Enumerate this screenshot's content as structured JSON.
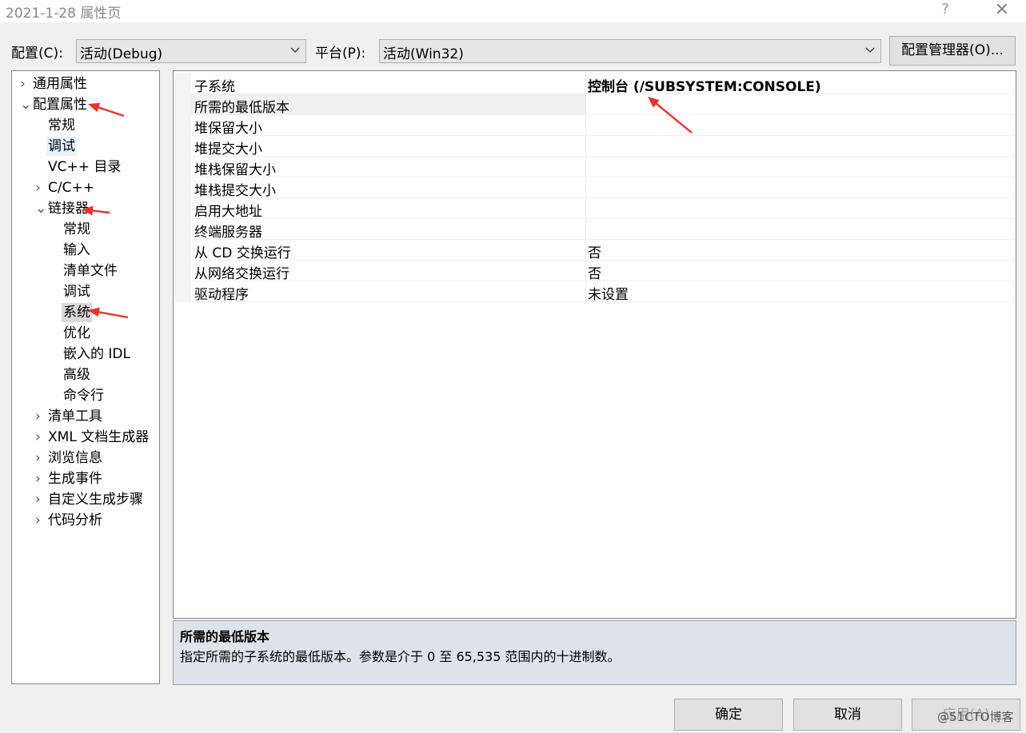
{
  "window": {
    "title": "2021-1-28 属性页",
    "help": "?",
    "close": "✕"
  },
  "config": {
    "label": "配置(C):",
    "value": "活动(Debug)"
  },
  "platform": {
    "label": "平台(P):",
    "value": "活动(Win32)"
  },
  "config_manager_label": "配置管理器(O)...",
  "tree": {
    "items": [
      {
        "label": "通用属性",
        "expander": "›"
      },
      {
        "label": "配置属性",
        "expander": "⌄"
      },
      {
        "label": "常规"
      },
      {
        "label": "调试"
      },
      {
        "label": "VC++ 目录"
      },
      {
        "label": "C/C++",
        "expander": "›"
      },
      {
        "label": "链接器",
        "expander": "⌄"
      },
      {
        "label": "常规"
      },
      {
        "label": "输入"
      },
      {
        "label": "清单文件"
      },
      {
        "label": "调试"
      },
      {
        "label": "系统"
      },
      {
        "label": "优化"
      },
      {
        "label": "嵌入的 IDL"
      },
      {
        "label": "高级"
      },
      {
        "label": "命令行"
      },
      {
        "label": "清单工具",
        "expander": "›"
      },
      {
        "label": "XML 文档生成器",
        "expander": "›"
      },
      {
        "label": "浏览信息",
        "expander": "›"
      },
      {
        "label": "生成事件",
        "expander": "›"
      },
      {
        "label": "自定义生成步骤",
        "expander": "›"
      },
      {
        "label": "代码分析",
        "expander": "›"
      }
    ]
  },
  "properties": [
    {
      "name": "子系统",
      "value": "控制台 (/SUBSYSTEM:CONSOLE)"
    },
    {
      "name": "所需的最低版本",
      "value": ""
    },
    {
      "name": "堆保留大小",
      "value": ""
    },
    {
      "name": "堆提交大小",
      "value": ""
    },
    {
      "name": "堆栈保留大小",
      "value": ""
    },
    {
      "name": "堆栈提交大小",
      "value": ""
    },
    {
      "name": "启用大地址",
      "value": ""
    },
    {
      "name": "终端服务器",
      "value": ""
    },
    {
      "name": "从 CD 交换运行",
      "value": "否"
    },
    {
      "name": "从网络交换运行",
      "value": "否"
    },
    {
      "name": "驱动程序",
      "value": "未设置"
    }
  ],
  "description": {
    "title": "所需的最低版本",
    "text": "指定所需的子系统的最低版本。参数是介于 0 至 65,535 范围内的十进制数。"
  },
  "buttons": {
    "ok": "确定",
    "cancel": "取消",
    "apply": "应用(A)"
  },
  "watermark": "@51CTO博客",
  "colors": {
    "annotation_arrow": "#e8322d"
  }
}
